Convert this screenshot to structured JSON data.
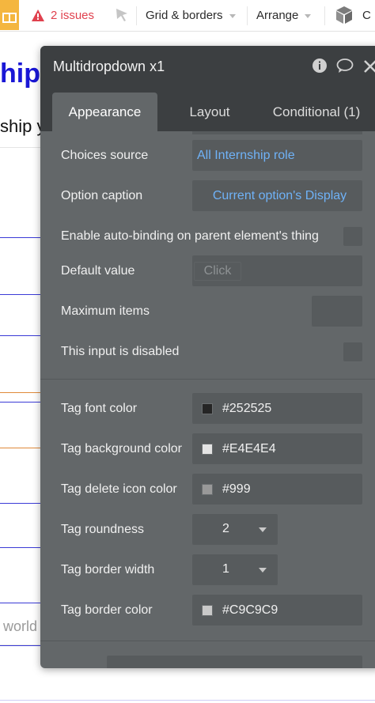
{
  "toolbar": {
    "issues_label": "2 issues",
    "grid_label": "Grid & borders",
    "arrange_label": "Arrange",
    "last_partial": "C",
    "accent": "#e0414e"
  },
  "background": {
    "title_partial": "hip",
    "subtitle_partial": "ship y",
    "input_partial": "world"
  },
  "panel": {
    "title": "Multidropdown x1",
    "tabs": [
      {
        "label": "Appearance",
        "active": true
      },
      {
        "label": "Layout",
        "active": false
      },
      {
        "label": "Conditional (1)",
        "active": false
      }
    ],
    "rows": {
      "choices_source": {
        "label": "Choices source",
        "value": "All Internship role"
      },
      "option_caption": {
        "label": "Option caption",
        "value": "Current option's Display"
      },
      "auto_binding": {
        "label": "Enable auto-binding on parent element's thing"
      },
      "default_value": {
        "label": "Default value",
        "button": "Click"
      },
      "maximum_items": {
        "label": "Maximum items"
      },
      "disabled": {
        "label": "This input is disabled"
      },
      "tag_font_color": {
        "label": "Tag font color",
        "value": "#252525"
      },
      "tag_bg_color": {
        "label": "Tag background color",
        "value": "#E4E4E4"
      },
      "tag_delete_color": {
        "label": "Tag delete icon color",
        "value": "#999"
      },
      "tag_roundness": {
        "label": "Tag roundness",
        "value": "2"
      },
      "tag_border_width": {
        "label": "Tag border width",
        "value": "1"
      },
      "tag_border_color": {
        "label": "Tag border color",
        "value": "#C9C9C9"
      }
    }
  },
  "colors": {
    "panel_bg": "#636769",
    "panel_header": "#3c3f41",
    "field_bg": "#575b5d",
    "link": "#6fb2f7"
  }
}
